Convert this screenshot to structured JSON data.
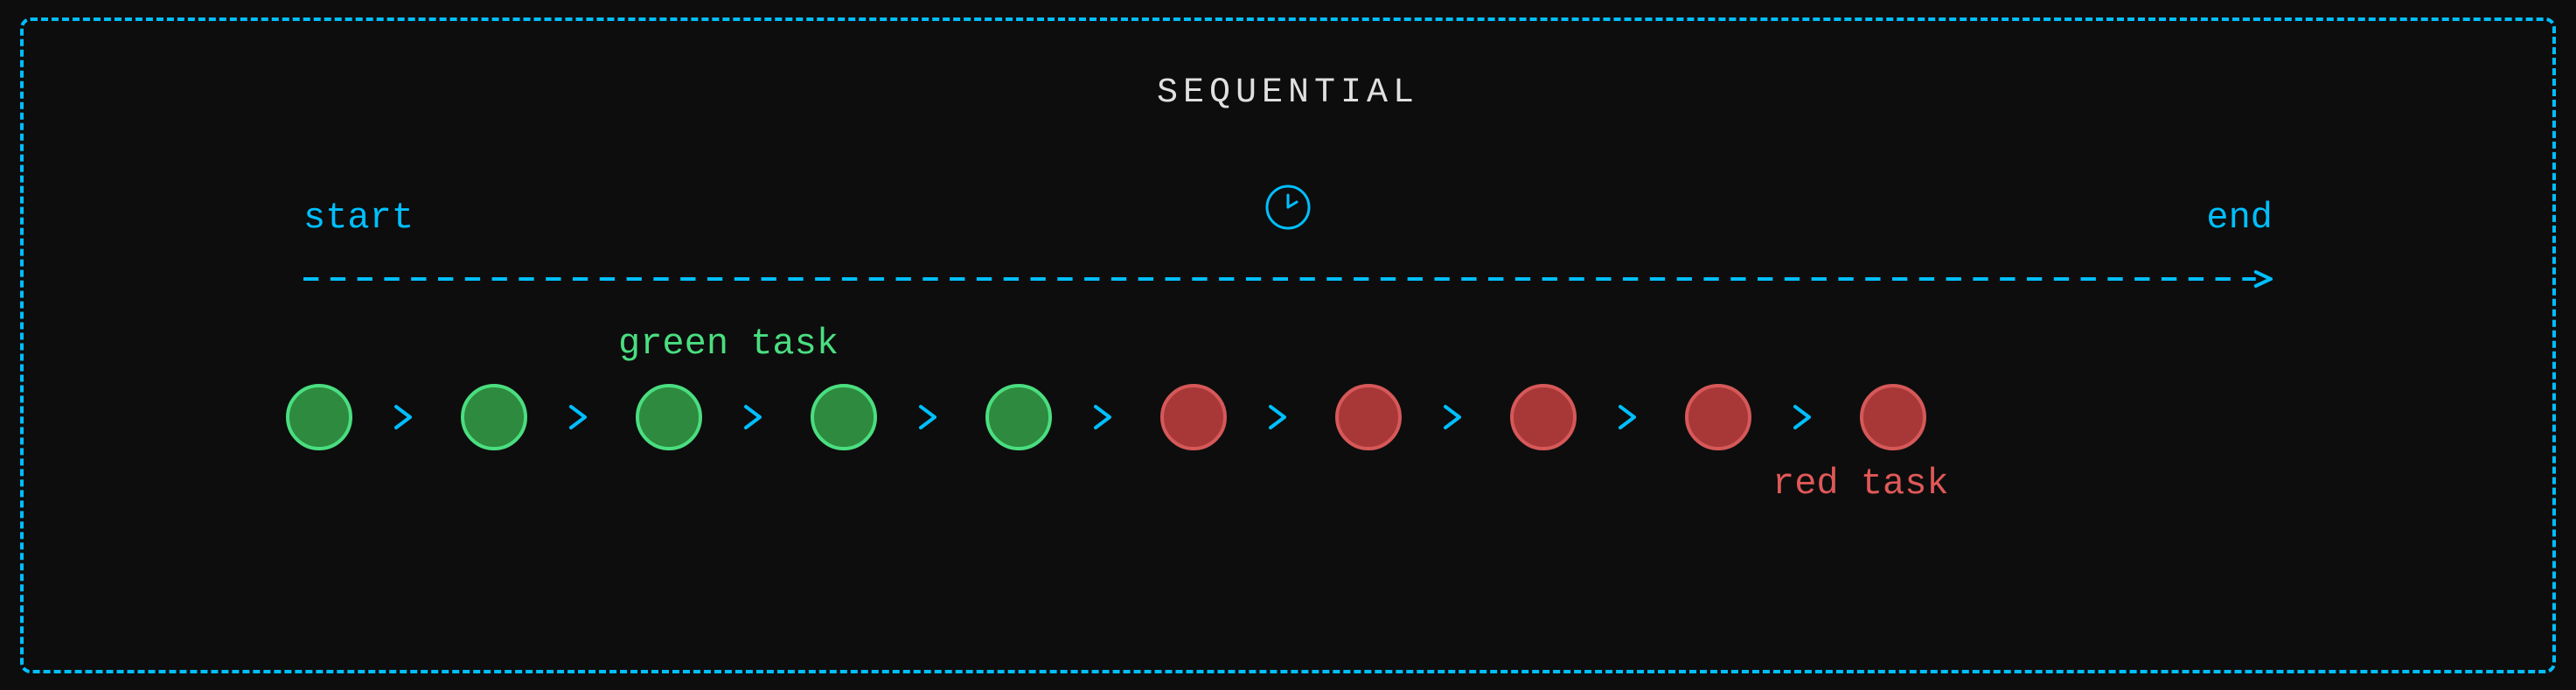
{
  "title": "SEQUENTIAL",
  "timeline": {
    "start_label": "start",
    "end_label": "end"
  },
  "labels": {
    "green_task": "green task",
    "red_task": "red task"
  },
  "tasks": [
    {
      "type": "green"
    },
    {
      "type": "green"
    },
    {
      "type": "green"
    },
    {
      "type": "green"
    },
    {
      "type": "green"
    },
    {
      "type": "red"
    },
    {
      "type": "red"
    },
    {
      "type": "red"
    },
    {
      "type": "red"
    },
    {
      "type": "red"
    }
  ],
  "colors": {
    "accent": "#00bfff",
    "green_fill": "#2d8a3e",
    "green_stroke": "#4ade80",
    "red_fill": "#a83838",
    "red_stroke": "#d65858",
    "text_light": "#e0e0e0"
  }
}
